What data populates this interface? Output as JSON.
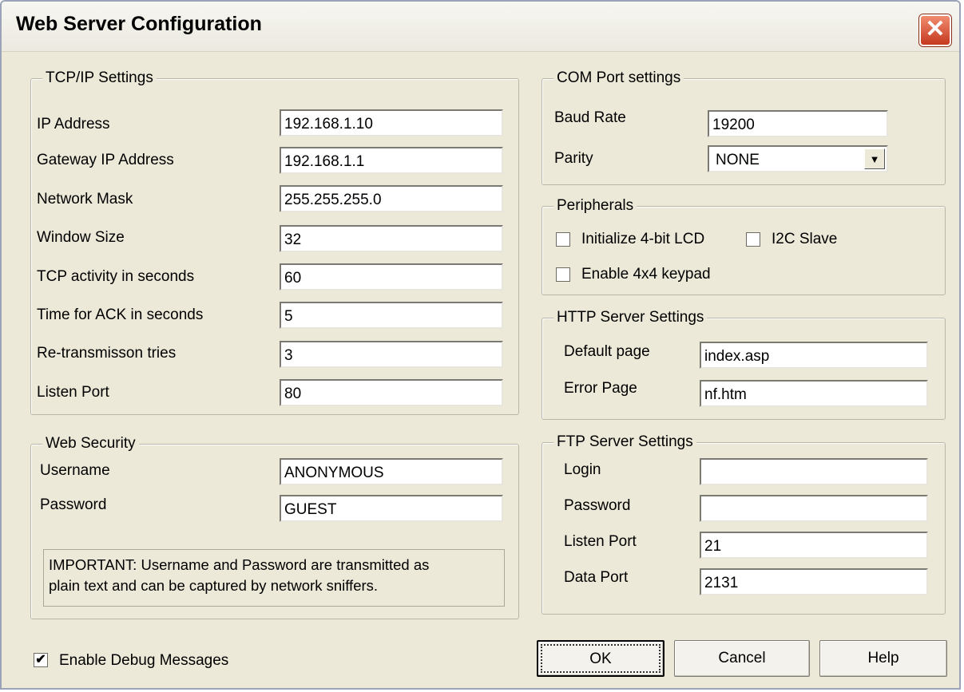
{
  "window": {
    "title": "Web Server Configuration",
    "close_glyph": "✕"
  },
  "tcpip": {
    "legend": "TCP/IP Settings",
    "fields": [
      {
        "label": "IP Address",
        "value": "192.168.1.10"
      },
      {
        "label": "Gateway IP Address",
        "value": "192.168.1.1"
      },
      {
        "label": "Network Mask",
        "value": "255.255.255.0"
      },
      {
        "label": "Window Size",
        "value": "32"
      },
      {
        "label": "TCP activity in seconds",
        "value": "60"
      },
      {
        "label": "Time for ACK in seconds",
        "value": "5"
      },
      {
        "label": "Re-transmisson tries",
        "value": "3"
      },
      {
        "label": "Listen Port",
        "value": "80"
      }
    ]
  },
  "security": {
    "legend": "Web Security",
    "username_label": "Username",
    "username_value": "ANONYMOUS",
    "password_label": "Password",
    "password_value": "GUEST",
    "notice_line1": "IMPORTANT: Username and Password are transmitted as",
    "notice_line2": "plain text and can be captured by network sniffers."
  },
  "com": {
    "legend": "COM Port settings",
    "baud_label": "Baud Rate",
    "baud_value": "19200",
    "parity_label": "Parity",
    "parity_value": "NONE"
  },
  "peripherals": {
    "legend": "Peripherals",
    "lcd_label": "Initialize 4-bit LCD",
    "lcd_checked": false,
    "i2c_label": "I2C Slave",
    "i2c_checked": false,
    "keypad_label": "Enable 4x4 keypad",
    "keypad_checked": false
  },
  "http": {
    "legend": "HTTP Server Settings",
    "default_label": "Default page",
    "default_value": "index.asp",
    "error_label": "Error Page",
    "error_value": "nf.htm"
  },
  "ftp": {
    "legend": "FTP Server Settings",
    "login_label": "Login",
    "login_value": "",
    "password_label": "Password",
    "password_value": "",
    "listen_label": "Listen Port",
    "listen_value": "21",
    "data_label": "Data Port",
    "data_value": "2131"
  },
  "debug": {
    "label": "Enable Debug Messages",
    "checked": true,
    "check_glyph": "✔"
  },
  "buttons": {
    "ok": "OK",
    "cancel": "Cancel",
    "help": "Help"
  },
  "icons": {
    "dropdown": "chevron-down-icon",
    "close": "close-icon"
  }
}
